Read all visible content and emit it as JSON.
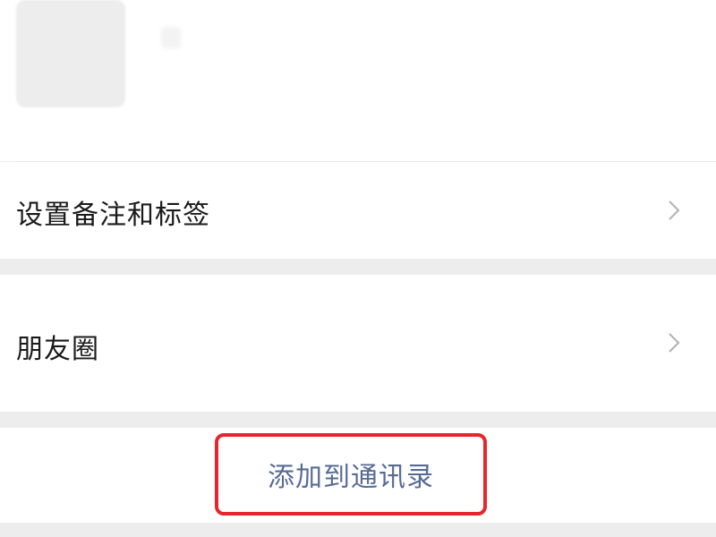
{
  "profile": {
    "avatar_icon": "avatar-placeholder",
    "name": ""
  },
  "menu": {
    "items": [
      {
        "label": "设置备注和标签",
        "icon": "chevron-right-icon"
      },
      {
        "label": "朋友圈",
        "icon": "chevron-right-icon"
      }
    ]
  },
  "action": {
    "add_to_contacts_label": "添加到通讯录"
  },
  "colors": {
    "background": "#ededed",
    "card": "#ffffff",
    "text": "#1a1a1a",
    "link": "#576b95",
    "highlight": "#e6262d",
    "chevron": "#b2b2b2"
  }
}
